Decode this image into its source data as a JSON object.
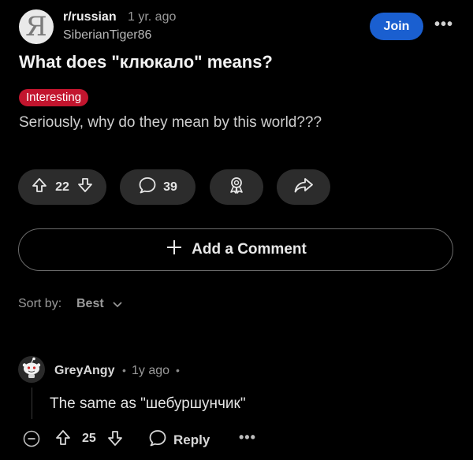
{
  "post": {
    "subreddit": "r/russian",
    "subreddit_avatar_glyph": "Я",
    "time": "1 yr. ago",
    "author": "SiberianTiger86",
    "join_label": "Join",
    "more_glyph": "•••",
    "title": "What does \"клюкало\" means?",
    "flair": "Interesting",
    "body": "Seriously, why do they mean by this world???",
    "votes": "22",
    "comments": "39"
  },
  "comment_box": {
    "label": "Add a Comment"
  },
  "sort": {
    "label": "Sort by:",
    "value": "Best"
  },
  "comment": {
    "author": "GreyAngy",
    "dot": "•",
    "time": "1y ago",
    "text": "The same as \"шебуршунчик\"",
    "votes": "25",
    "reply_label": "Reply",
    "more_glyph": "•••"
  },
  "colors": {
    "accent": "#1a5fd0",
    "flair": "#c2152e",
    "background": "#000000",
    "pill": "#2c2c2c"
  },
  "icons": [
    "upvote-icon",
    "downvote-icon",
    "comment-icon",
    "award-icon",
    "share-icon",
    "plus-icon",
    "chevron-down-icon",
    "collapse-icon",
    "reply-icon",
    "snoo-avatar-icon"
  ]
}
